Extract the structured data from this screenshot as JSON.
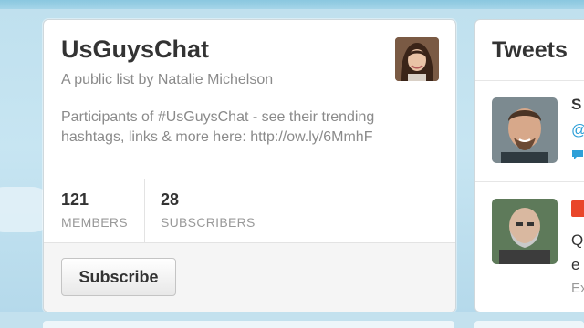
{
  "list": {
    "title": "UsGuysChat",
    "byline": "A public list by Natalie Michelson",
    "description": "Participants of #UsGuysChat - see their trending hashtags, links & more here: http://ow.ly/6MmhF",
    "members": {
      "count": "121",
      "label": "MEMBERS"
    },
    "subscribers": {
      "count": "28",
      "label": "SUBSCRIBERS"
    },
    "subscribe_label": "Subscribe"
  },
  "tweets": {
    "title": "Tweets",
    "items": [
      {
        "name_fragment": "S",
        "handle_fragment": "@",
        "avatar": "man-smiling-avatar"
      },
      {
        "text_fragment": "Q\ne",
        "meta_fragment": "Ex",
        "avatar": "bald-man-avatar"
      }
    ]
  },
  "colors": {
    "background": "#c7e5f2",
    "link": "#2fa0d8",
    "badge": "#e9462a"
  }
}
